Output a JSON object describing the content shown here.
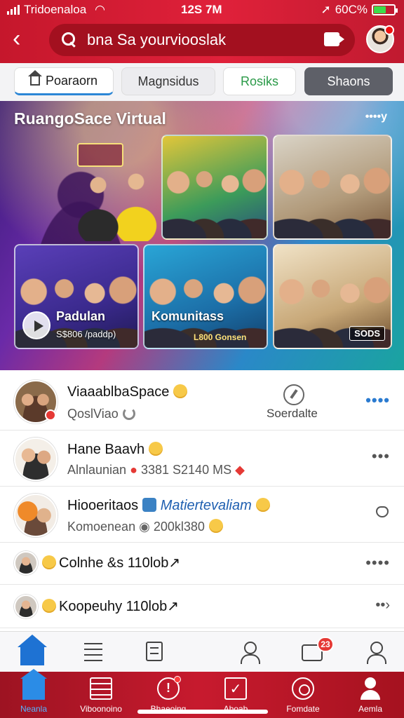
{
  "status_bar": {
    "carrier": "Tridoenaloa",
    "time": "12S 7M",
    "battery": "60C%",
    "battery_level": 0.6
  },
  "search": {
    "placeholder": "bna Sa yourviooslak"
  },
  "tabs": [
    {
      "label": "Poaraorn"
    },
    {
      "label": "Magnsidus"
    },
    {
      "label": "Rosiks"
    },
    {
      "label": "Shaons"
    }
  ],
  "banner": {
    "title": "RuangoSace Virtual",
    "more": "••••y",
    "tile_c": {
      "label": "Padulan",
      "sub": "S$806 /paddp)"
    },
    "tile_d": {
      "label": "Komunitass",
      "sub": "L800 Gonsen"
    },
    "tile_e": {
      "badge": "SODS"
    }
  },
  "list": [
    {
      "name": "ViaaablbaSpace",
      "sub": "QoslViao",
      "side_label": "Soerdalte",
      "more": "••••"
    },
    {
      "name": "Hane Baavh",
      "sub": "Alnlaunian",
      "sub2": "3381 S2140 MS",
      "more": "•••"
    },
    {
      "name": "Hiooeritaos",
      "name_link": "Matiertevaliam",
      "sub": "Komoenean",
      "sub2": "200kl380"
    },
    {
      "name": "Colnhe &s 110lob↗",
      "more": "••••"
    },
    {
      "name": "Koopeuhy 110lob↗",
      "more": "••›"
    }
  ],
  "secondary_tabs": {
    "badge": "23"
  },
  "bottom_nav": [
    {
      "label": "Neanla",
      "icon": "home-icon"
    },
    {
      "label": "Viboonoino",
      "icon": "grid-icon"
    },
    {
      "label": "Bhaeoing",
      "icon": "alert-icon"
    },
    {
      "label": "Aboab",
      "icon": "check-icon"
    },
    {
      "label": "Fomdate",
      "icon": "globe-icon"
    },
    {
      "label": "Aemla",
      "icon": "person-icon"
    }
  ],
  "colors": {
    "brand_red": "#c5172c",
    "accent_blue": "#2b86d6",
    "active_blue": "#1e72d3"
  }
}
